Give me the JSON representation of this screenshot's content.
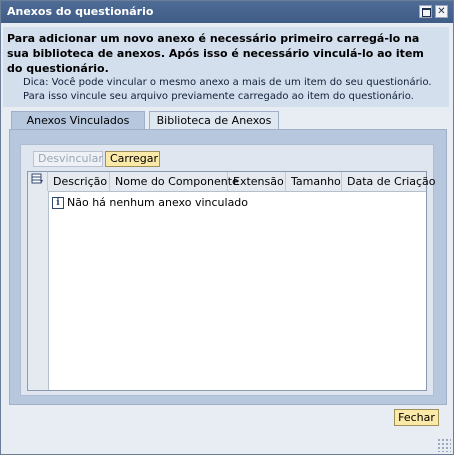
{
  "window": {
    "title": "Anexos do questionário",
    "maximize_icon": "maximize-icon",
    "close_icon": "close-icon",
    "close_glyph": "✕"
  },
  "info": {
    "main": "Para adicionar um novo anexo é necessário primeiro carregá-lo na sua biblioteca de anexos. Após isso é necessário vinculá-lo ao item do questionário.",
    "tip": "Dica: Você pode vincular o mesmo anexo a mais de um item do seu questionário. Para isso vincule seu arquivo previamente carregado ao item do questionário."
  },
  "tabs": [
    {
      "label": "Anexos Vinculados",
      "active": true
    },
    {
      "label": "Biblioteca de Anexos",
      "active": false
    }
  ],
  "toolbar": {
    "unlink_label": "Desvincular",
    "unlink_disabled": true,
    "load_label": "Carregar"
  },
  "grid": {
    "selector_icon": "table-settings-icon",
    "columns": [
      "Descrição",
      "Nome do Componente",
      "Extensão",
      "Tamanho",
      "Data de Criação"
    ],
    "empty_message": "Não há nenhum anexo vinculado",
    "empty_icon": "info-icon",
    "empty_icon_glyph": "i"
  },
  "footer": {
    "close_label": "Fechar"
  },
  "colors": {
    "titlebar": "#4f6c97",
    "info_bg": "#d4dfee",
    "tab_active": "#b6c7de",
    "button_highlight": "#fbe9a8"
  }
}
